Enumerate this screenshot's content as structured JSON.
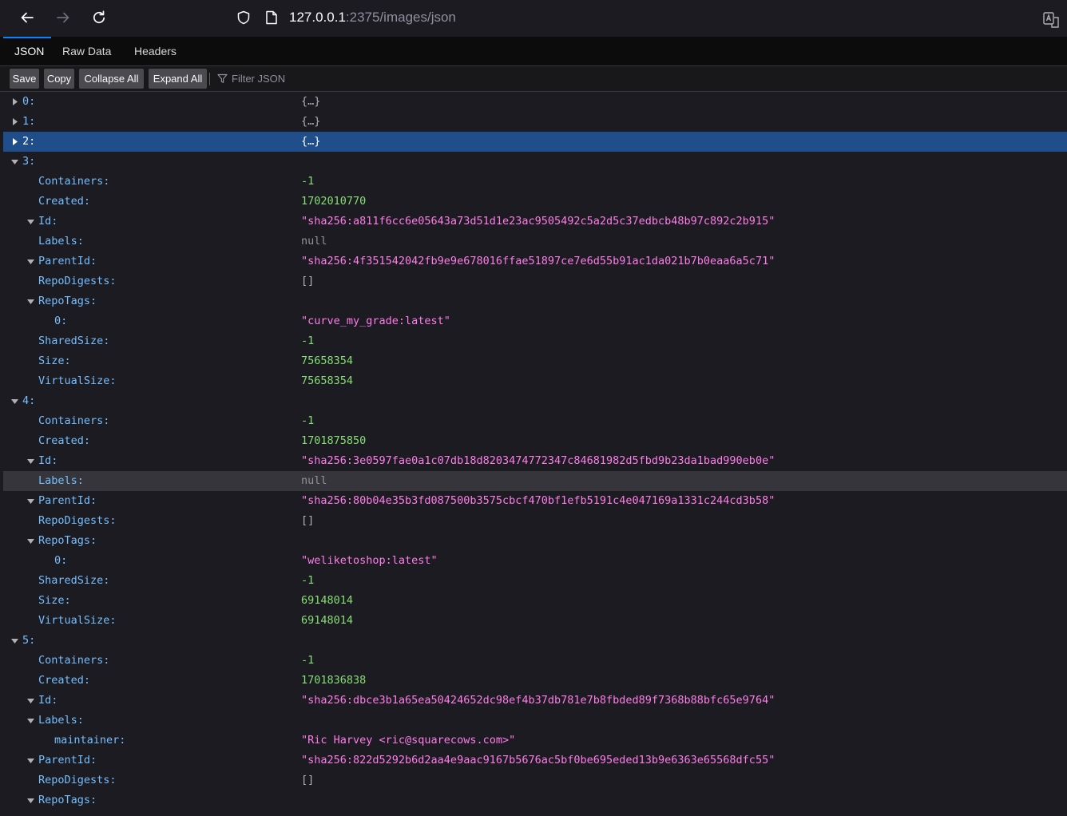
{
  "browser": {
    "url_host": "127.0.0.1",
    "url_rest": ":2375/images/json"
  },
  "tabs": {
    "json": "JSON",
    "raw": "Raw Data",
    "headers": "Headers"
  },
  "toolbar": {
    "save": "Save",
    "copy": "Copy",
    "collapse": "Collapse All",
    "expand": "Expand All",
    "filter_placeholder": "Filter JSON"
  },
  "rows": [
    {
      "depth": 0,
      "key": "0:",
      "value": "{…}",
      "type": "obj",
      "twisty": "collapsed"
    },
    {
      "depth": 0,
      "key": "1:",
      "value": "{…}",
      "type": "obj",
      "twisty": "collapsed"
    },
    {
      "depth": 0,
      "key": "2:",
      "value": "{…}",
      "type": "obj",
      "twisty": "collapsed",
      "selected": true
    },
    {
      "depth": 0,
      "key": "3:",
      "value": "",
      "type": "obj",
      "twisty": "expanded"
    },
    {
      "depth": 1,
      "key": "Containers:",
      "value": "-1",
      "type": "num"
    },
    {
      "depth": 1,
      "key": "Created:",
      "value": "1702010770",
      "type": "num"
    },
    {
      "depth": 1,
      "key": "Id:",
      "value": "\"sha256:a811f6cc6e05643a73d51d1e23ac9505492c5a2d5c37edbcb48b97c892c2b915\"",
      "type": "str",
      "twisty": "expanded"
    },
    {
      "depth": 1,
      "key": "Labels:",
      "value": "null",
      "type": "null"
    },
    {
      "depth": 1,
      "key": "ParentId:",
      "value": "\"sha256:4f351542042fb9e9e678016ffae51897ce7e6d55b91ac1da021b7b0eaa6a5c71\"",
      "type": "str",
      "twisty": "expanded"
    },
    {
      "depth": 1,
      "key": "RepoDigests:",
      "value": "[]",
      "type": "arr"
    },
    {
      "depth": 1,
      "key": "RepoTags:",
      "value": "",
      "type": "arr",
      "twisty": "expanded"
    },
    {
      "depth": 2,
      "key": "0:",
      "value": "\"curve_my_grade:latest\"",
      "type": "str"
    },
    {
      "depth": 1,
      "key": "SharedSize:",
      "value": "-1",
      "type": "num"
    },
    {
      "depth": 1,
      "key": "Size:",
      "value": "75658354",
      "type": "num"
    },
    {
      "depth": 1,
      "key": "VirtualSize:",
      "value": "75658354",
      "type": "num"
    },
    {
      "depth": 0,
      "key": "4:",
      "value": "",
      "type": "obj",
      "twisty": "expanded"
    },
    {
      "depth": 1,
      "key": "Containers:",
      "value": "-1",
      "type": "num"
    },
    {
      "depth": 1,
      "key": "Created:",
      "value": "1701875850",
      "type": "num"
    },
    {
      "depth": 1,
      "key": "Id:",
      "value": "\"sha256:3e0597fae0a1c07db18d8203474772347c84681982d5fbd9b23da1bad990eb0e\"",
      "type": "str",
      "twisty": "expanded"
    },
    {
      "depth": 1,
      "key": "Labels:",
      "value": "null",
      "type": "null",
      "hover": true
    },
    {
      "depth": 1,
      "key": "ParentId:",
      "value": "\"sha256:80b04e35b3fd087500b3575cbcf470bf1efb5191c4e047169a1331c244cd3b58\"",
      "type": "str",
      "twisty": "expanded"
    },
    {
      "depth": 1,
      "key": "RepoDigests:",
      "value": "[]",
      "type": "arr"
    },
    {
      "depth": 1,
      "key": "RepoTags:",
      "value": "",
      "type": "arr",
      "twisty": "expanded"
    },
    {
      "depth": 2,
      "key": "0:",
      "value": "\"weliketoshop:latest\"",
      "type": "str"
    },
    {
      "depth": 1,
      "key": "SharedSize:",
      "value": "-1",
      "type": "num"
    },
    {
      "depth": 1,
      "key": "Size:",
      "value": "69148014",
      "type": "num"
    },
    {
      "depth": 1,
      "key": "VirtualSize:",
      "value": "69148014",
      "type": "num"
    },
    {
      "depth": 0,
      "key": "5:",
      "value": "",
      "type": "obj",
      "twisty": "expanded"
    },
    {
      "depth": 1,
      "key": "Containers:",
      "value": "-1",
      "type": "num"
    },
    {
      "depth": 1,
      "key": "Created:",
      "value": "1701836838",
      "type": "num"
    },
    {
      "depth": 1,
      "key": "Id:",
      "value": "\"sha256:dbce3b1a65ea50424652dc98ef4b37db781e7b8fbded89f7368b88bfc65e9764\"",
      "type": "str",
      "twisty": "expanded"
    },
    {
      "depth": 1,
      "key": "Labels:",
      "value": "",
      "type": "obj",
      "twisty": "expanded"
    },
    {
      "depth": 2,
      "key": "maintainer:",
      "value": "\"Ric Harvey <ric@squarecows.com>\"",
      "type": "str"
    },
    {
      "depth": 1,
      "key": "ParentId:",
      "value": "\"sha256:822d5292b6d2aa4e9aac9167b5676ac5bf0be695eded13b9e6363e65568dfc55\"",
      "type": "str",
      "twisty": "expanded"
    },
    {
      "depth": 1,
      "key": "RepoDigests:",
      "value": "[]",
      "type": "arr"
    },
    {
      "depth": 1,
      "key": "RepoTags:",
      "value": "",
      "type": "arr",
      "twisty": "expanded"
    }
  ]
}
